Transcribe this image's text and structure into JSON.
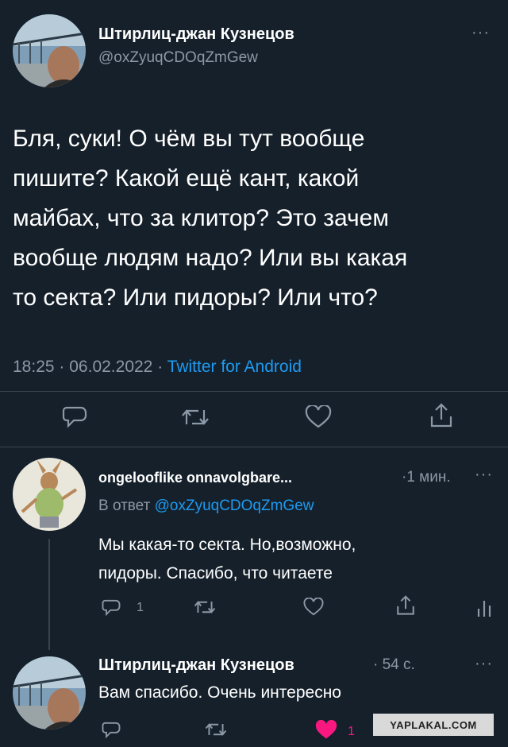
{
  "main_tweet": {
    "author_name": "Штирлиц-джан Кузнецов",
    "author_handle": "@oxZyuqCDOqZmGew",
    "text_lines": [
      "Бля, суки! О чём вы тут вообще",
      "пишите? Какой ещё кант, какой",
      "майбах, что за клитор? Это зачем",
      "вообще людям надо? Или вы какая",
      "то секта? Или пидоры? Или что?"
    ],
    "time": "18:25",
    "date": "06.02.2022",
    "separator": "·",
    "source": "Twitter for Android",
    "more": "···"
  },
  "reply1": {
    "author_name": "ongelooflike onnavolgbare...",
    "time": "·1 мин.",
    "reply_to_prefix": "В ответ",
    "reply_to_handle": "@oxZyuqCDOqZmGew",
    "text_lines": [
      "Мы какая-то секта. Но,возможно,",
      "пидоры. Спасибо, что читаете"
    ],
    "reply_count": "1",
    "more": "···"
  },
  "reply2": {
    "author_name": "Штирлиц-джан Кузнецов",
    "time": "· 54 с.",
    "text": "Вам спасибо. Очень интересно",
    "like_count": "1",
    "more": "···"
  },
  "watermark": "YAPLAKAL.COM",
  "colors": {
    "background": "#15202b",
    "text": "#e7e9ea",
    "muted": "#8b98a5",
    "link": "#1d9bf0",
    "like": "#f91880"
  }
}
